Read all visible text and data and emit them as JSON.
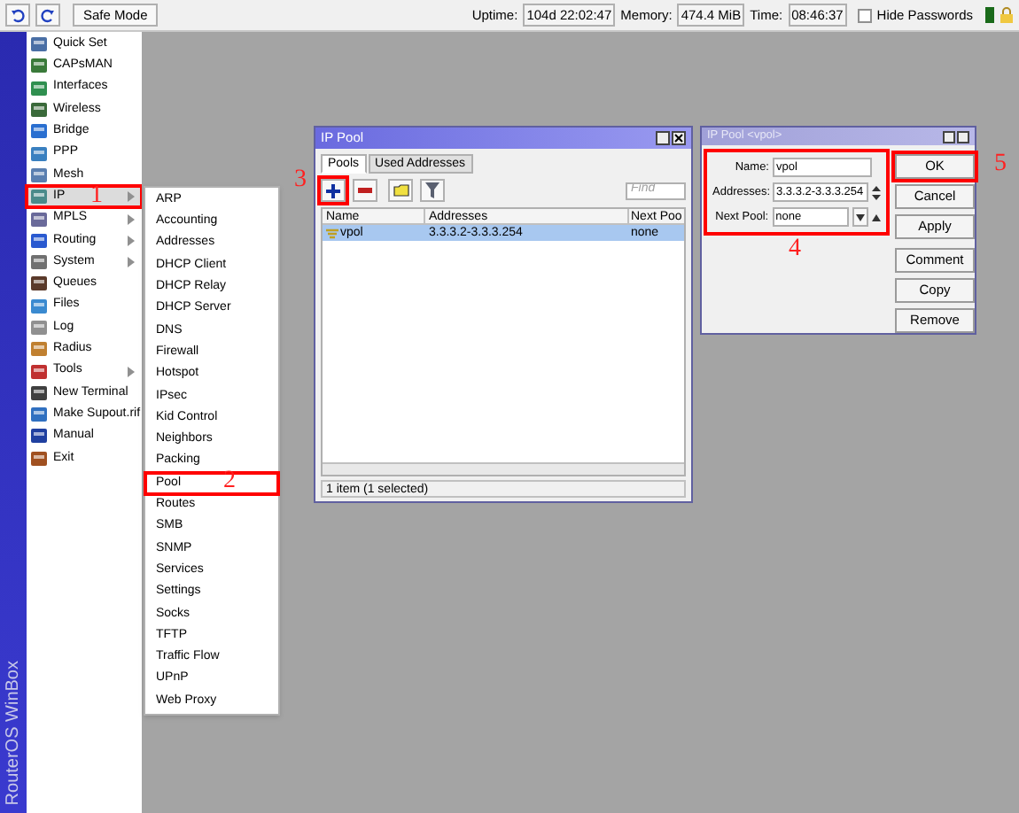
{
  "toolbar": {
    "safe_mode": "Safe Mode",
    "uptime_label": "Uptime:",
    "uptime": "104d 22:02:47",
    "memory_label": "Memory:",
    "memory": "474.4 MiB",
    "time_label": "Time:",
    "time": "08:46:37",
    "hide_passwords": {
      "label": "Hide Passwords",
      "checked": false
    }
  },
  "brand": "RouterOS WinBox",
  "sidebar": {
    "items": [
      {
        "label": "Quick Set",
        "submenu": false,
        "selected": false
      },
      {
        "label": "CAPsMAN",
        "submenu": false,
        "selected": false
      },
      {
        "label": "Interfaces",
        "submenu": false,
        "selected": false
      },
      {
        "label": "Wireless",
        "submenu": false,
        "selected": false
      },
      {
        "label": "Bridge",
        "submenu": false,
        "selected": false
      },
      {
        "label": "PPP",
        "submenu": false,
        "selected": false
      },
      {
        "label": "Mesh",
        "submenu": false,
        "selected": false
      },
      {
        "label": "IP",
        "submenu": true,
        "selected": true,
        "annotation": "1"
      },
      {
        "label": "MPLS",
        "submenu": true,
        "selected": false
      },
      {
        "label": "Routing",
        "submenu": true,
        "selected": false
      },
      {
        "label": "System",
        "submenu": true,
        "selected": false
      },
      {
        "label": "Queues",
        "submenu": false,
        "selected": false
      },
      {
        "label": "Files",
        "submenu": false,
        "selected": false
      },
      {
        "label": "Log",
        "submenu": false,
        "selected": false
      },
      {
        "label": "Radius",
        "submenu": false,
        "selected": false
      },
      {
        "label": "Tools",
        "submenu": true,
        "selected": false
      },
      {
        "label": "New Terminal",
        "submenu": false,
        "selected": false
      },
      {
        "label": "Make Supout.rif",
        "submenu": false,
        "selected": false
      },
      {
        "label": "Manual",
        "submenu": false,
        "selected": false
      },
      {
        "label": "Exit",
        "submenu": false,
        "selected": false
      }
    ]
  },
  "submenu": {
    "items": [
      {
        "label": "ARP"
      },
      {
        "label": "Accounting"
      },
      {
        "label": "Addresses"
      },
      {
        "label": "DHCP Client"
      },
      {
        "label": "DHCP Relay"
      },
      {
        "label": "DHCP Server"
      },
      {
        "label": "DNS"
      },
      {
        "label": "Firewall"
      },
      {
        "label": "Hotspot"
      },
      {
        "label": "IPsec"
      },
      {
        "label": "Kid Control"
      },
      {
        "label": "Neighbors"
      },
      {
        "label": "Packing"
      },
      {
        "label": "Pool",
        "annotation": "2"
      },
      {
        "label": "Routes"
      },
      {
        "label": "SMB"
      },
      {
        "label": "SNMP"
      },
      {
        "label": "Services"
      },
      {
        "label": "Settings"
      },
      {
        "label": "Socks"
      },
      {
        "label": "TFTP"
      },
      {
        "label": "Traffic Flow"
      },
      {
        "label": "UPnP"
      },
      {
        "label": "Web Proxy"
      }
    ]
  },
  "ip_pool_window": {
    "title": "IP Pool",
    "tabs": [
      {
        "label": "Pools",
        "selected": true
      },
      {
        "label": "Used Addresses",
        "selected": false
      }
    ],
    "add_annotation": "3",
    "find": {
      "placeholder": "Find"
    },
    "columns": [
      "Name",
      "Addresses",
      "Next Poo"
    ],
    "rows": [
      {
        "name": "vpol",
        "addresses": "3.3.3.2-3.3.3.254",
        "next_pool": "none",
        "selected": true
      }
    ],
    "status": "1 item (1 selected)"
  },
  "pool_dialog": {
    "title": "IP Pool <vpol>",
    "form_annotation": "4",
    "fields": [
      {
        "label": "Name:",
        "value": "vpol",
        "kind": "text"
      },
      {
        "label": "Addresses:",
        "value": "3.3.3.2-3.3.3.254",
        "kind": "list"
      },
      {
        "label": "Next Pool:",
        "value": "none",
        "kind": "dropdown"
      }
    ],
    "buttons": [
      {
        "label": "OK",
        "annotation": "5"
      },
      {
        "label": "Cancel"
      },
      {
        "label": "Apply"
      },
      {
        "label": "Comment"
      },
      {
        "label": "Copy"
      },
      {
        "label": "Remove"
      }
    ]
  }
}
